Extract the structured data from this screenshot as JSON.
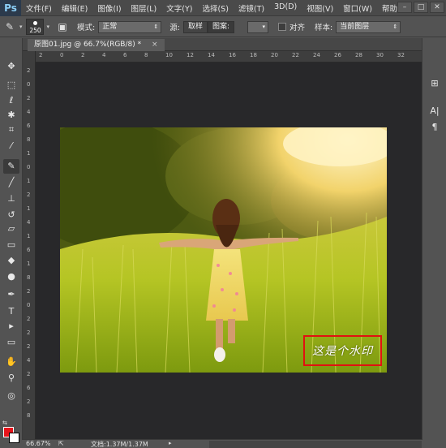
{
  "app": {
    "logo": "Ps"
  },
  "menu": [
    "文件(F)",
    "编辑(E)",
    "图像(I)",
    "图层(L)",
    "文字(Y)",
    "选择(S)",
    "滤镜(T)",
    "3D(D)",
    "视图(V)",
    "窗口(W)",
    "帮助(H)"
  ],
  "window_controls": {
    "minimize": "–",
    "restore": "□",
    "close": "✕"
  },
  "options": {
    "brush_size": "250",
    "mode_label": "模式:",
    "mode_value": "正常",
    "source_label": "源:",
    "source_sampled": "取样",
    "source_pattern": "图案:",
    "align_label": "对齐",
    "sample_label": "样本:",
    "sample_value": "当前图层"
  },
  "document": {
    "tab_title": "原图01.jpg @ 66.7%(RGB/8) *",
    "tab_close": "×"
  },
  "ruler": {
    "top_labels": [
      "2",
      "0",
      "2",
      "4",
      "6",
      "8",
      "10",
      "12",
      "14",
      "16",
      "18",
      "20",
      "22",
      "24",
      "26",
      "28",
      "30",
      "32"
    ],
    "left_labels": [
      "2",
      "0",
      "2",
      "4",
      "6",
      "8",
      "1",
      "0",
      "1",
      "2",
      "1",
      "4",
      "1",
      "6",
      "1",
      "8",
      "2",
      "0",
      "2",
      "2",
      "2",
      "4",
      "2",
      "6",
      "2",
      "8"
    ]
  },
  "tools": [
    {
      "name": "move-tool-icon",
      "glyph": "✥"
    },
    {
      "name": "marquee-tool-icon",
      "glyph": "⬚"
    },
    {
      "name": "lasso-tool-icon",
      "glyph": "ℓ"
    },
    {
      "name": "quick-select-tool-icon",
      "glyph": "✱"
    },
    {
      "name": "crop-tool-icon",
      "glyph": "⌗"
    },
    {
      "name": "eyedropper-tool-icon",
      "glyph": "⁄"
    },
    {
      "name": "healing-brush-tool-icon",
      "glyph": "✎"
    },
    {
      "name": "brush-tool-icon",
      "glyph": "╱"
    },
    {
      "name": "clone-stamp-tool-icon",
      "glyph": "⊥"
    },
    {
      "name": "history-brush-tool-icon",
      "glyph": "↺"
    },
    {
      "name": "eraser-tool-icon",
      "glyph": "▱"
    },
    {
      "name": "gradient-tool-icon",
      "glyph": "▭"
    },
    {
      "name": "blur-tool-icon",
      "glyph": "◆"
    },
    {
      "name": "dodge-tool-icon",
      "glyph": "●"
    },
    {
      "name": "pen-tool-icon",
      "glyph": "✒"
    },
    {
      "name": "type-tool-icon",
      "glyph": "T"
    },
    {
      "name": "path-select-tool-icon",
      "glyph": "▸"
    },
    {
      "name": "shape-tool-icon",
      "glyph": "▭"
    },
    {
      "name": "hand-tool-icon",
      "glyph": "✋"
    },
    {
      "name": "zoom-tool-icon",
      "glyph": "⚲"
    }
  ],
  "colors": {
    "foreground": "#e8141b",
    "background": "#ffffff",
    "watermark_box": "#e11111"
  },
  "watermark": {
    "text": "这是个水印"
  },
  "right_panel": [
    {
      "name": "history-panel-icon",
      "glyph": "⊞"
    },
    {
      "name": "character-panel-icon",
      "glyph": "A|"
    },
    {
      "name": "paragraph-panel-icon",
      "glyph": "¶"
    }
  ],
  "status": {
    "zoom": "66.67%",
    "doc_info": "文档:1.37M/1.37M",
    "arrow": "▸"
  }
}
